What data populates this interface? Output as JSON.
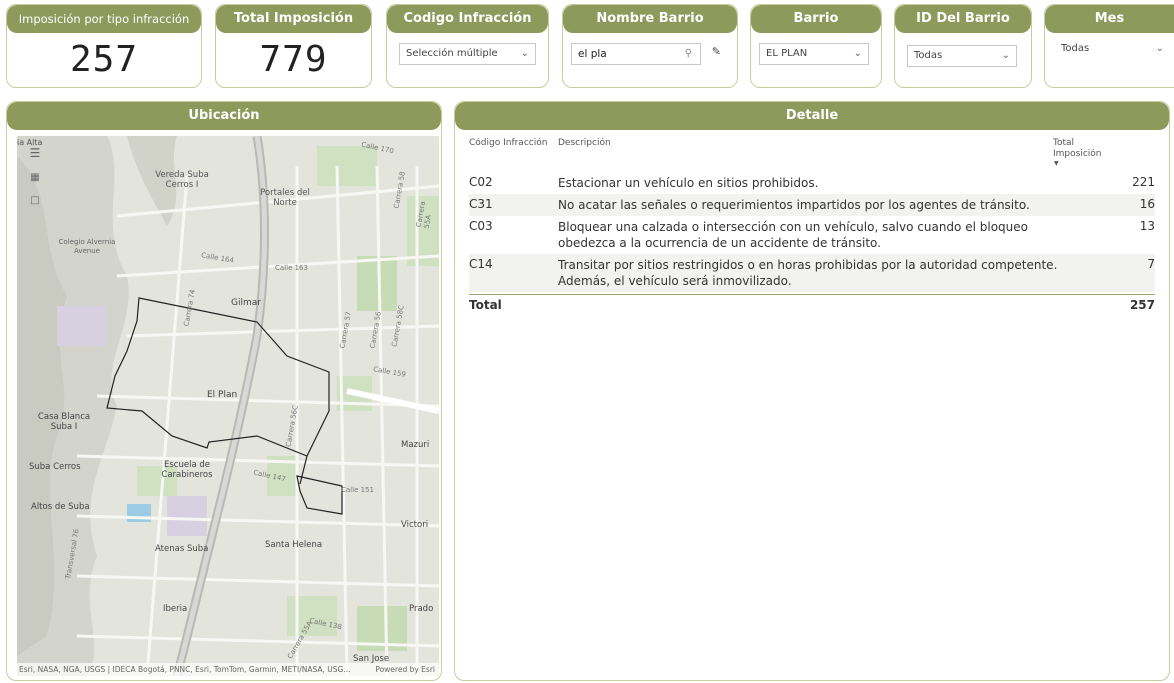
{
  "kpis": {
    "imposicion_tipo": {
      "label": "Imposición por tipo infracción",
      "value": "257"
    },
    "total_imposicion": {
      "label": "Total Imposición",
      "value": "779"
    }
  },
  "slicers": {
    "codigo": {
      "label": "Codigo Infracción",
      "value": "Selección múltiple"
    },
    "nombre_barrio": {
      "label": "Nombre Barrio",
      "value": "el pla"
    },
    "barrio": {
      "label": "Barrio",
      "value": "EL PLAN"
    },
    "id_barrio": {
      "label": "ID Del Barrio",
      "value": "Todas"
    },
    "mes": {
      "label": "Mes",
      "value": "Todas"
    }
  },
  "map": {
    "title": "Ubicación",
    "attribution": "Esri, NASA, NGA, USGS | IDECA Bogotá, PNNC, Esri, TomTom, Garmin, METI/NASA, USG...",
    "powered": "Powered by Esri",
    "labels": [
      "Vereda Suba Cerros I",
      "Portales del Norte",
      "Colegio Alvernia Avenue",
      "Gilmar",
      "El Plan",
      "Casa Blanca Suba I",
      "Suba Cerros",
      "Escuela de Carabineros",
      "Altos de Suba",
      "Atenas Suba",
      "Santa Helena",
      "Iberia",
      "San Jose",
      "Mazuri",
      "Victori",
      "Prado",
      "ia Alta"
    ],
    "streets": [
      "Calle 170",
      "Calle 164",
      "Calle 163",
      "Calle 159",
      "Calle 151",
      "Calle 147",
      "Calle 138",
      "Carrera 74",
      "Carrera 58",
      "Carrera 56",
      "Carrera 55A",
      "Carrera 57",
      "Carrera 58C",
      "Carrera 56C",
      "Transversal 76",
      "Carrera 55A"
    ]
  },
  "detail": {
    "title": "Detalle",
    "headers": {
      "codigo": "Código Infracción",
      "descripcion": "Descripción",
      "total": "Total Imposición"
    },
    "rows": [
      {
        "codigo": "C02",
        "descripcion": "Estacionar un vehículo en sitios prohibidos.",
        "total": "221"
      },
      {
        "codigo": "C31",
        "descripcion": "No acatar las señales o requerimientos impartidos por los agentes de tránsito.",
        "total": "16"
      },
      {
        "codigo": "C03",
        "descripcion": "Bloquear una calzada o intersección con un vehículo, salvo cuando el bloqueo obedezca a la ocurrencia de un accidente de tránsito.",
        "total": "13"
      },
      {
        "codigo": "C14",
        "descripcion": "Transitar por sitios restringidos o en horas prohibidas por la autoridad competente. Además, el vehículo será inmovilizado.",
        "total": "7"
      }
    ],
    "total_label": "Total",
    "total_value": "257"
  },
  "icons": {
    "menu": "hamburger-icon",
    "select": "lasso-select-icon",
    "rect": "rect-select-icon",
    "search": "search-icon",
    "eraser": "eraser-icon",
    "chevron": "chevron-down-icon",
    "sort": "sort-desc-icon"
  },
  "colors": {
    "header": "#8d9a5b",
    "border": "#c8cc9c"
  }
}
